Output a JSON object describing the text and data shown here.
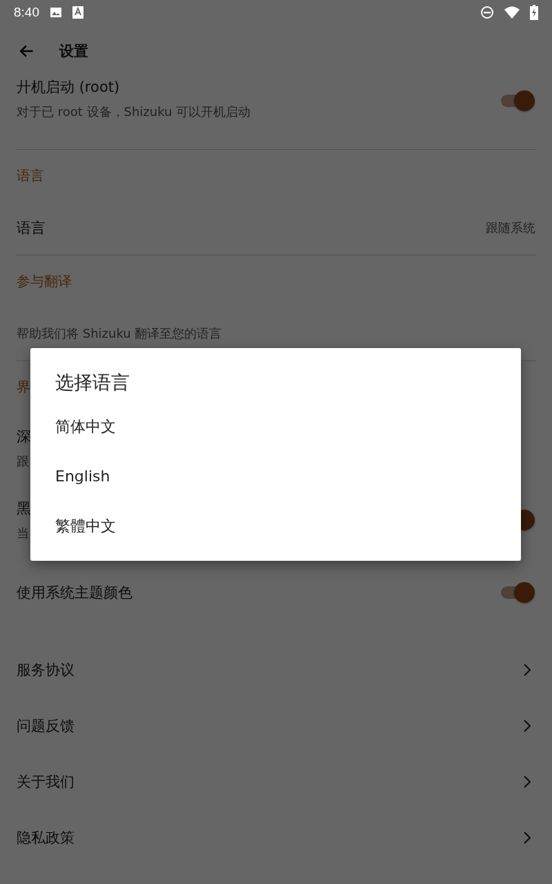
{
  "status_bar": {
    "time": "8:40"
  },
  "toolbar": {
    "title": "设置"
  },
  "sections": [
    {
      "items": [
        {
          "kind": "switch",
          "title": "廾机启动 (root)",
          "summary": "对于已 root 设备，Shizuku 可以开机启动",
          "on": true
        }
      ]
    },
    {
      "heading": "语言",
      "items": [
        {
          "kind": "value",
          "title": "语言",
          "value": "跟随系统"
        }
      ]
    },
    {
      "heading": "参与翻译",
      "items": [
        {
          "kind": "text",
          "summary": "帮助我们将 Shizuku 翻译至您的语言"
        }
      ]
    },
    {
      "heading": "界",
      "items": [
        {
          "kind": "text",
          "title": "深",
          "summary": "跟"
        },
        {
          "kind": "switch",
          "title": "黑",
          "summary": "当",
          "on": true
        },
        {
          "kind": "switch",
          "title": "使用系统主题颜色",
          "on": true
        }
      ]
    },
    {
      "items": [
        {
          "kind": "link",
          "title": "服务协议"
        },
        {
          "kind": "link",
          "title": "问题反馈"
        },
        {
          "kind": "link",
          "title": "关于我们"
        },
        {
          "kind": "link",
          "title": "隐私政策"
        }
      ]
    }
  ],
  "dialog": {
    "title": "选择语言",
    "options": [
      "简体中文",
      "English",
      "繁體中文"
    ]
  }
}
